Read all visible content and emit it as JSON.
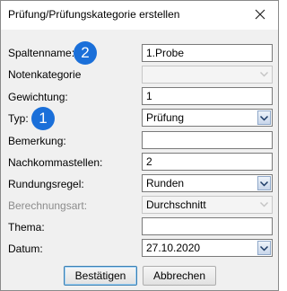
{
  "window": {
    "title": "Prüfung/Prüfungskategorie erstellen",
    "close_glyph": "✕"
  },
  "badges": {
    "one": "1",
    "two": "2",
    "color": "#1a6fd9"
  },
  "form": {
    "spaltenname": {
      "label": "Spaltenname:",
      "value": "1.Probe"
    },
    "notenkategorie": {
      "label": "Notenkategorie",
      "value": ""
    },
    "gewichtung": {
      "label": "Gewichtung:",
      "value": "1"
    },
    "typ": {
      "label": "Typ:",
      "value": "Prüfung"
    },
    "bemerkung": {
      "label": "Bemerkung:",
      "value": ""
    },
    "nachkommastellen": {
      "label": "Nachkommastellen:",
      "value": "2"
    },
    "rundungsregel": {
      "label": "Rundungsregel:",
      "value": "Runden"
    },
    "berechnungsart": {
      "label": "Berechnungsart:",
      "value": "Durchschnitt"
    },
    "thema": {
      "label": "Thema:",
      "value": ""
    },
    "datum": {
      "label": "Datum:",
      "value": "27.10.2020"
    }
  },
  "buttons": {
    "confirm": "Bestätigen",
    "cancel": "Abbrechen"
  },
  "icons": {
    "close": "close-icon",
    "dropdown": "chevron-down-icon"
  }
}
